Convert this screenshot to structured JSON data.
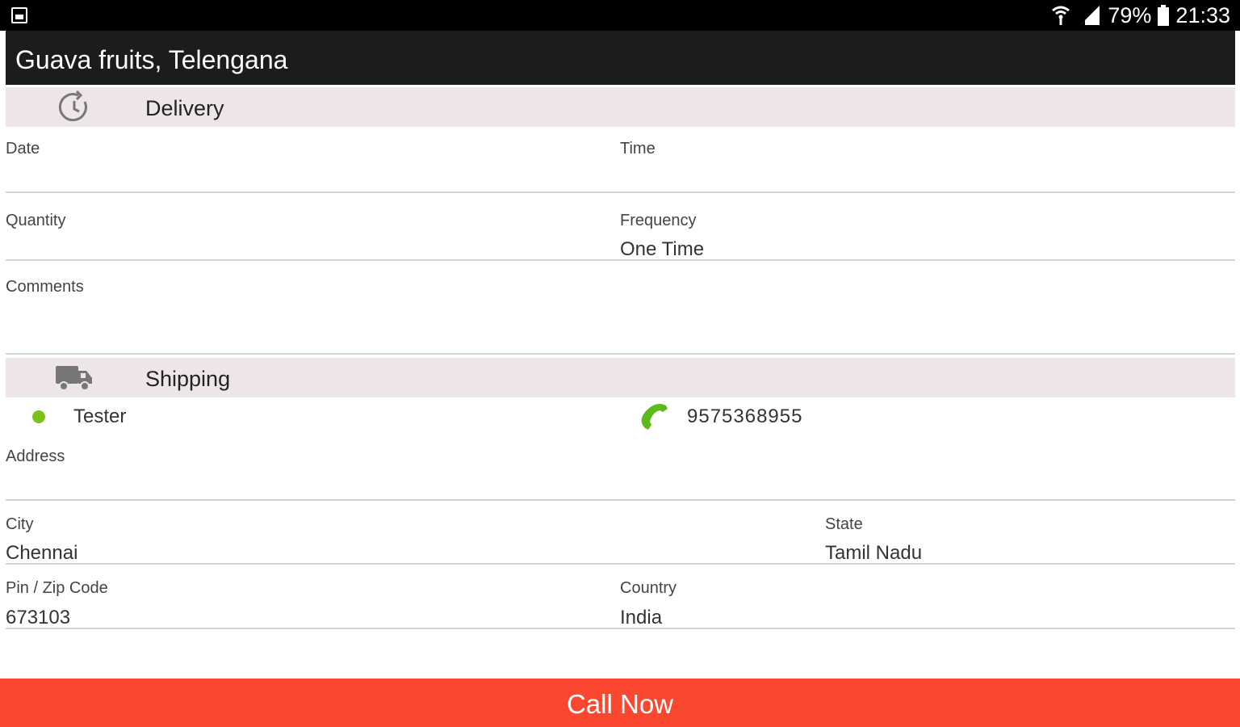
{
  "status_bar": {
    "battery": "79%",
    "time": "21:33",
    "icons": [
      "notification-icon",
      "wifi-icon",
      "signal-icon",
      "battery-icon"
    ]
  },
  "app_bar": {
    "title": "Guava fruits, Telengana"
  },
  "delivery": {
    "header": "Delivery",
    "icon": "clock-refresh-icon",
    "date_label": "Date",
    "date_value": "",
    "time_label": "Time",
    "time_value": "",
    "quantity_label": "Quantity",
    "quantity_value": "",
    "frequency_label": "Frequency",
    "frequency_value": "One Time",
    "comments_label": "Comments",
    "comments_value": ""
  },
  "shipping": {
    "header": "Shipping",
    "icon": "truck-icon",
    "contact_name": "Tester",
    "phone": "9575368955",
    "address_label": "Address",
    "address_value": "",
    "city_label": "City",
    "city_value": "Chennai",
    "state_label": "State",
    "state_value": "Tamil Nadu",
    "pin_label": "Pin / Zip Code",
    "pin_value": "673103",
    "country_label": "Country",
    "country_value": "India"
  },
  "actions": {
    "call_now": "Call Now"
  },
  "colors": {
    "app_bar": "#1c1c1c",
    "section_header": "#eee6e6",
    "accent_green": "#7cc21a",
    "call_button": "#fb4730"
  }
}
